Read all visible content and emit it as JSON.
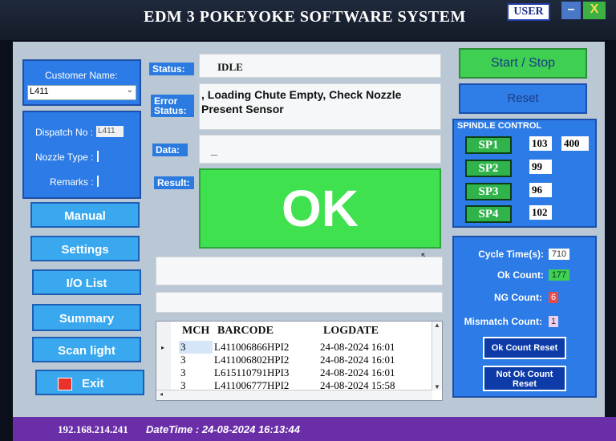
{
  "window": {
    "title": "EDM 3 POKEYOKE SOFTWARE SYSTEM",
    "user_badge": "USER",
    "minimize": "–",
    "close": "X"
  },
  "left": {
    "customer_label": "Customer Name:",
    "customer_value": "L411",
    "dispatch_label": "Dispatch No :",
    "dispatch_value": "L411",
    "nozzle_label": "Nozzle Type :",
    "remarks_label": "Remarks :",
    "nav": [
      "Manual",
      "Settings",
      "I/O List",
      "Summary",
      "Scan light",
      "Exit"
    ]
  },
  "center": {
    "status_label": "Status:",
    "status_value": "IDLE",
    "error_label_1": "Error",
    "error_label_2": "Status:",
    "error_value": ", Loading Chute Empty, Check Nozzle Present Sensor",
    "data_label": "Data:",
    "data_value": "_",
    "result_label": "Result:",
    "result_value": "OK"
  },
  "table": {
    "headers": [
      "MCH",
      "BARCODE",
      "LOGDATE"
    ],
    "rows": [
      {
        "mch": "3",
        "barcode": "L411006866HPI2",
        "logdate": "24-08-2024 16:01"
      },
      {
        "mch": "3",
        "barcode": "L411006802HPI2",
        "logdate": "24-08-2024 16:01"
      },
      {
        "mch": "3",
        "barcode": "L615110791HPI3",
        "logdate": "24-08-2024 16:01"
      },
      {
        "mch": "3",
        "barcode": "L411006777HPI2",
        "logdate": "24-08-2024 15:58"
      }
    ]
  },
  "right": {
    "start_stop": "Start / Stop",
    "reset": "Reset",
    "spindle_title": "SPINDLE CONTROL",
    "spindles": [
      {
        "label": "SP1",
        "value": "103"
      },
      {
        "label": "SP2",
        "value": "99"
      },
      {
        "label": "SP3",
        "value": "96"
      },
      {
        "label": "SP4",
        "value": "102"
      }
    ],
    "sp1_extra": "400",
    "cycle_label": "Cycle Time(s):",
    "cycle_value": "710",
    "ok_label": "Ok Count:",
    "ok_value": "177",
    "ng_label": "NG Count:",
    "ng_value": "6",
    "mismatch_label": "Mismatch Count:",
    "mismatch_value": "1",
    "ok_reset": "Ok Count Reset",
    "notok_reset_1": "Not Ok Count",
    "notok_reset_2": "Reset"
  },
  "statusbar": {
    "ip": "192.168.214.241",
    "datetime": "DateTime : 24-08-2024 16:13:44"
  },
  "colors": {
    "result_ok": "#3fe24e",
    "panel_blue": "#2c7be6",
    "statusbar": "#6a2fa8"
  }
}
